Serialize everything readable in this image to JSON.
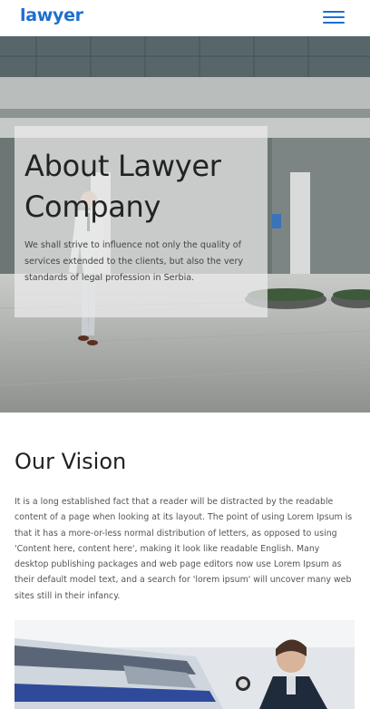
{
  "header": {
    "logo": "lawyer",
    "menu_icon": "hamburger-menu-icon",
    "accent_color": "#1e6fd0"
  },
  "hero": {
    "title": "About Lawyer Company",
    "text": "We shall strive to influence not only the quality of services extended to the clients, but also the very standards of legal profession in Serbia."
  },
  "vision": {
    "title": "Our Vision",
    "text": "It is a long established fact that a reader will be distracted by the readable content of a page when looking at its layout. The point of using Lorem Ipsum is that it has a more-or-less normal distribution of letters, as opposed to using 'Content here, content here', making it look like readable English. Many desktop publishing packages and web page editors now use Lorem Ipsum as their default model text, and a search for 'lorem ipsum' will uncover many web sites still in their infancy."
  }
}
